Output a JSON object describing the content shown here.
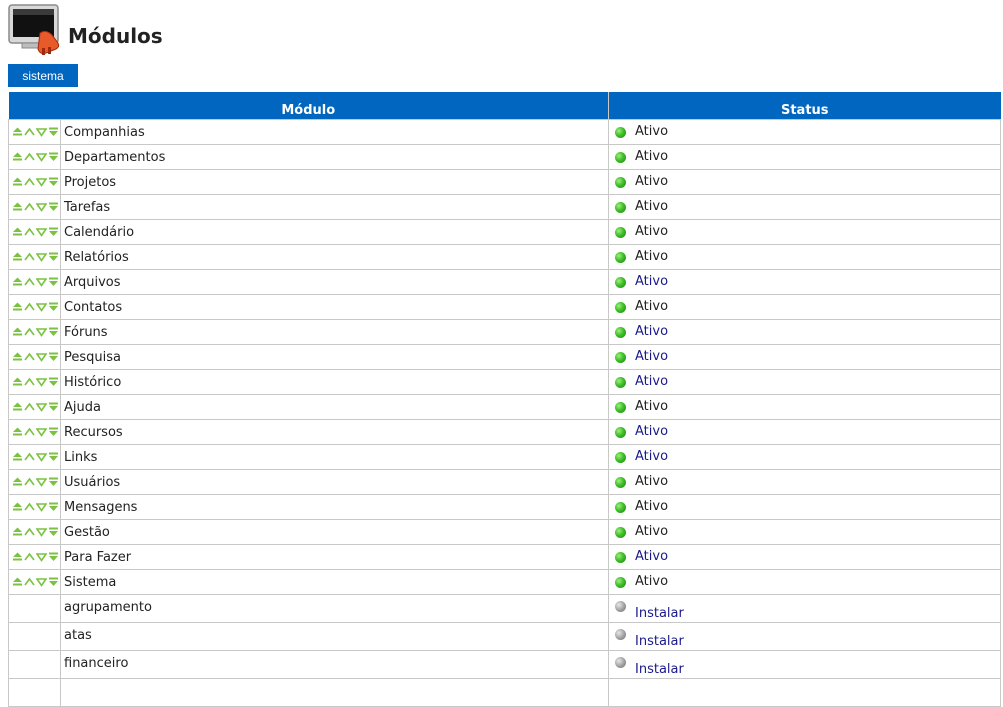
{
  "page": {
    "title": "Módulos",
    "icon": "monitor-plug-icon"
  },
  "tabs": [
    {
      "label": "sistema"
    }
  ],
  "table": {
    "headers": {
      "module": "Módulo",
      "status": "Status"
    },
    "rows": [
      {
        "name": "Companhias",
        "status": "Ativo",
        "status_link": false,
        "arrows": true,
        "dot": "green"
      },
      {
        "name": "Departamentos",
        "status": "Ativo",
        "status_link": false,
        "arrows": true,
        "dot": "green"
      },
      {
        "name": "Projetos",
        "status": "Ativo",
        "status_link": false,
        "arrows": true,
        "dot": "green"
      },
      {
        "name": "Tarefas",
        "status": "Ativo",
        "status_link": false,
        "arrows": true,
        "dot": "green"
      },
      {
        "name": "Calendário",
        "status": "Ativo",
        "status_link": false,
        "arrows": true,
        "dot": "green"
      },
      {
        "name": "Relatórios",
        "status": "Ativo",
        "status_link": false,
        "arrows": true,
        "dot": "green"
      },
      {
        "name": "Arquivos",
        "status": "Ativo",
        "status_link": true,
        "arrows": true,
        "dot": "green"
      },
      {
        "name": "Contatos",
        "status": "Ativo",
        "status_link": false,
        "arrows": true,
        "dot": "green"
      },
      {
        "name": "Fóruns",
        "status": "Ativo",
        "status_link": true,
        "arrows": true,
        "dot": "green"
      },
      {
        "name": "Pesquisa",
        "status": "Ativo",
        "status_link": true,
        "arrows": true,
        "dot": "green"
      },
      {
        "name": "Histórico",
        "status": "Ativo",
        "status_link": true,
        "arrows": true,
        "dot": "green"
      },
      {
        "name": "Ajuda",
        "status": "Ativo",
        "status_link": false,
        "arrows": true,
        "dot": "green"
      },
      {
        "name": "Recursos",
        "status": "Ativo",
        "status_link": true,
        "arrows": true,
        "dot": "green"
      },
      {
        "name": "Links",
        "status": "Ativo",
        "status_link": true,
        "arrows": true,
        "dot": "green"
      },
      {
        "name": "Usuários",
        "status": "Ativo",
        "status_link": false,
        "arrows": true,
        "dot": "green"
      },
      {
        "name": "Mensagens",
        "status": "Ativo",
        "status_link": false,
        "arrows": true,
        "dot": "green"
      },
      {
        "name": "Gestão",
        "status": "Ativo",
        "status_link": false,
        "arrows": true,
        "dot": "green"
      },
      {
        "name": "Para Fazer",
        "status": "Ativo",
        "status_link": true,
        "arrows": true,
        "dot": "green"
      },
      {
        "name": "Sistema",
        "status": "Ativo",
        "status_link": false,
        "arrows": true,
        "dot": "green"
      },
      {
        "name": "agrupamento",
        "status": "Instalar",
        "status_link": true,
        "arrows": false,
        "dot": "gray"
      },
      {
        "name": "atas",
        "status": "Instalar",
        "status_link": true,
        "arrows": false,
        "dot": "gray"
      },
      {
        "name": "financeiro",
        "status": "Instalar",
        "status_link": true,
        "arrows": false,
        "dot": "gray"
      },
      {
        "name": "",
        "status": "",
        "status_link": false,
        "arrows": false,
        "dot": ""
      }
    ]
  },
  "colors": {
    "accent": "#0066c0",
    "active_dot": "#3fbf2a",
    "inactive_dot": "#a5a5a5",
    "link": "#1a1a8c",
    "arrow": "#7cc242"
  }
}
